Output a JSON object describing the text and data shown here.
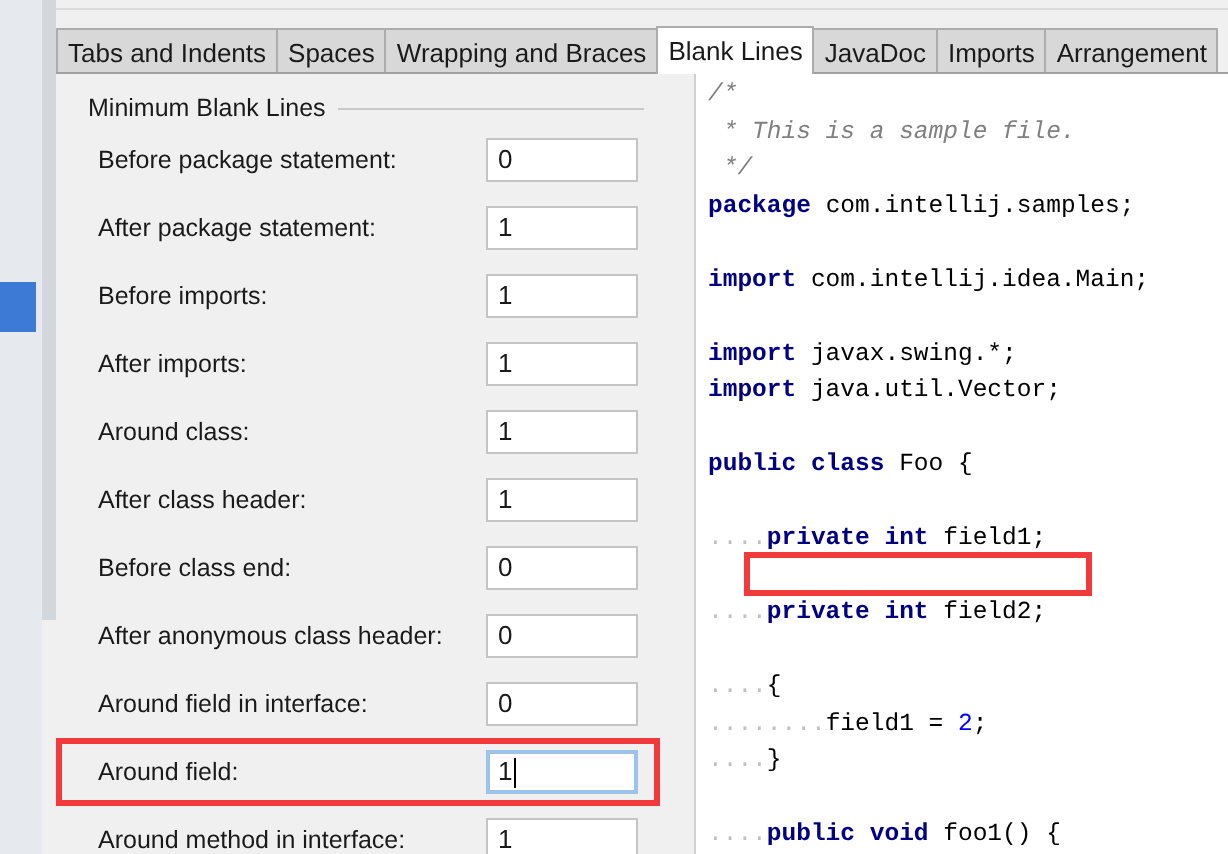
{
  "tabs": [
    {
      "label": "Tabs and Indents",
      "selected": false
    },
    {
      "label": "Spaces",
      "selected": false
    },
    {
      "label": "Wrapping and Braces",
      "selected": false
    },
    {
      "label": "Blank Lines",
      "selected": true
    },
    {
      "label": "JavaDoc",
      "selected": false
    },
    {
      "label": "Imports",
      "selected": false
    },
    {
      "label": "Arrangement",
      "selected": false
    }
  ],
  "section_title": "Minimum Blank Lines",
  "settings": [
    {
      "label": "Before package statement:",
      "value": "0",
      "focused": false,
      "highlighted": false
    },
    {
      "label": "After package statement:",
      "value": "1",
      "focused": false,
      "highlighted": false
    },
    {
      "label": "Before imports:",
      "value": "1",
      "focused": false,
      "highlighted": false
    },
    {
      "label": "After imports:",
      "value": "1",
      "focused": false,
      "highlighted": false
    },
    {
      "label": "Around class:",
      "value": "1",
      "focused": false,
      "highlighted": false
    },
    {
      "label": "After class header:",
      "value": "1",
      "focused": false,
      "highlighted": false
    },
    {
      "label": "Before class end:",
      "value": "0",
      "focused": false,
      "highlighted": false
    },
    {
      "label": "After anonymous class header:",
      "value": "0",
      "focused": false,
      "highlighted": false
    },
    {
      "label": "Around field in interface:",
      "value": "0",
      "focused": false,
      "highlighted": false
    },
    {
      "label": "Around field:",
      "value": "1",
      "focused": true,
      "highlighted": true
    },
    {
      "label": "Around method in interface:",
      "value": "1",
      "focused": false,
      "highlighted": false
    }
  ],
  "code_lines": [
    {
      "highlighted": false,
      "segments": [
        {
          "kind": "comment",
          "text": "/*"
        }
      ]
    },
    {
      "highlighted": false,
      "segments": [
        {
          "kind": "comment",
          "text": " * This is a sample file."
        }
      ]
    },
    {
      "highlighted": false,
      "segments": [
        {
          "kind": "comment",
          "text": " */"
        }
      ]
    },
    {
      "highlighted": false,
      "segments": [
        {
          "kind": "keyword",
          "text": "package"
        },
        {
          "kind": "plain",
          "text": " com.intellij.samples;"
        }
      ]
    },
    {
      "highlighted": false
    },
    {
      "highlighted": false,
      "segments": [
        {
          "kind": "keyword",
          "text": "import"
        },
        {
          "kind": "plain",
          "text": " com.intellij.idea.Main;"
        }
      ]
    },
    {
      "highlighted": false
    },
    {
      "highlighted": false,
      "segments": [
        {
          "kind": "keyword",
          "text": "import"
        },
        {
          "kind": "plain",
          "text": " javax.swing.*;"
        }
      ]
    },
    {
      "highlighted": false,
      "segments": [
        {
          "kind": "keyword",
          "text": "import"
        },
        {
          "kind": "plain",
          "text": " java.util.Vector;"
        }
      ]
    },
    {
      "highlighted": false
    },
    {
      "highlighted": false,
      "segments": [
        {
          "kind": "keyword",
          "text": "public class"
        },
        {
          "kind": "plain",
          "text": " Foo {"
        }
      ]
    },
    {
      "highlighted": false
    },
    {
      "highlighted": false,
      "segments": [
        {
          "kind": "whitespace",
          "text": "...."
        },
        {
          "kind": "keyword",
          "text": "private int"
        },
        {
          "kind": "plain",
          "text": " field1;"
        }
      ]
    },
    {
      "highlighted": true
    },
    {
      "highlighted": false,
      "segments": [
        {
          "kind": "whitespace",
          "text": "...."
        },
        {
          "kind": "keyword",
          "text": "private int"
        },
        {
          "kind": "plain",
          "text": " field2;"
        }
      ]
    },
    {
      "highlighted": false
    },
    {
      "highlighted": false,
      "segments": [
        {
          "kind": "whitespace",
          "text": "...."
        },
        {
          "kind": "plain",
          "text": "{"
        }
      ]
    },
    {
      "highlighted": false,
      "segments": [
        {
          "kind": "whitespace",
          "text": "........"
        },
        {
          "kind": "plain",
          "text": "field1 = "
        },
        {
          "kind": "number",
          "text": "2"
        },
        {
          "kind": "plain",
          "text": ";"
        }
      ]
    },
    {
      "highlighted": false,
      "segments": [
        {
          "kind": "whitespace",
          "text": "...."
        },
        {
          "kind": "plain",
          "text": "}"
        }
      ]
    },
    {
      "highlighted": false
    },
    {
      "highlighted": false,
      "segments": [
        {
          "kind": "whitespace",
          "text": "...."
        },
        {
          "kind": "keyword",
          "text": "public void"
        },
        {
          "kind": "plain",
          "text": " foo1() {"
        }
      ]
    }
  ]
}
